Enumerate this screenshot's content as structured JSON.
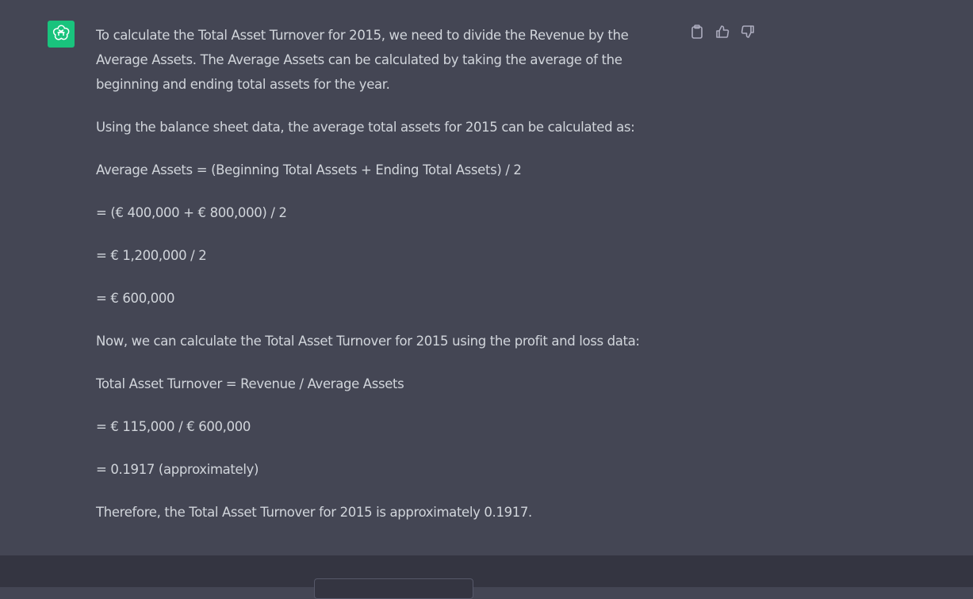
{
  "assistant": {
    "avatar_icon": "openai-logo-icon",
    "avatar_color": "#19c37d"
  },
  "message": {
    "paragraphs": [
      "To calculate the Total Asset Turnover for 2015, we need to divide the Revenue by the Average Assets. The Average Assets can be calculated by taking the average of the beginning and ending total assets for the year.",
      "Using the balance sheet data, the average total assets for 2015 can be calculated as:",
      "Average Assets = (Beginning Total Assets + Ending Total Assets) / 2",
      "= (€ 400,000 + € 800,000) / 2",
      "= € 1,200,000 / 2",
      "= € 600,000",
      "Now, we can calculate the Total Asset Turnover for 2015 using the profit and loss data:",
      "Total Asset Turnover = Revenue / Average Assets",
      "= € 115,000 / € 600,000",
      "= 0.1917 (approximately)",
      "Therefore, the Total Asset Turnover for 2015 is approximately 0.1917."
    ]
  },
  "actions": {
    "copy_icon": "clipboard-icon",
    "like_icon": "thumbs-up-icon",
    "dislike_icon": "thumbs-down-icon"
  },
  "theme": {
    "message_bg": "#444654",
    "page_bg": "#343541",
    "text_color": "#d1d5db"
  }
}
